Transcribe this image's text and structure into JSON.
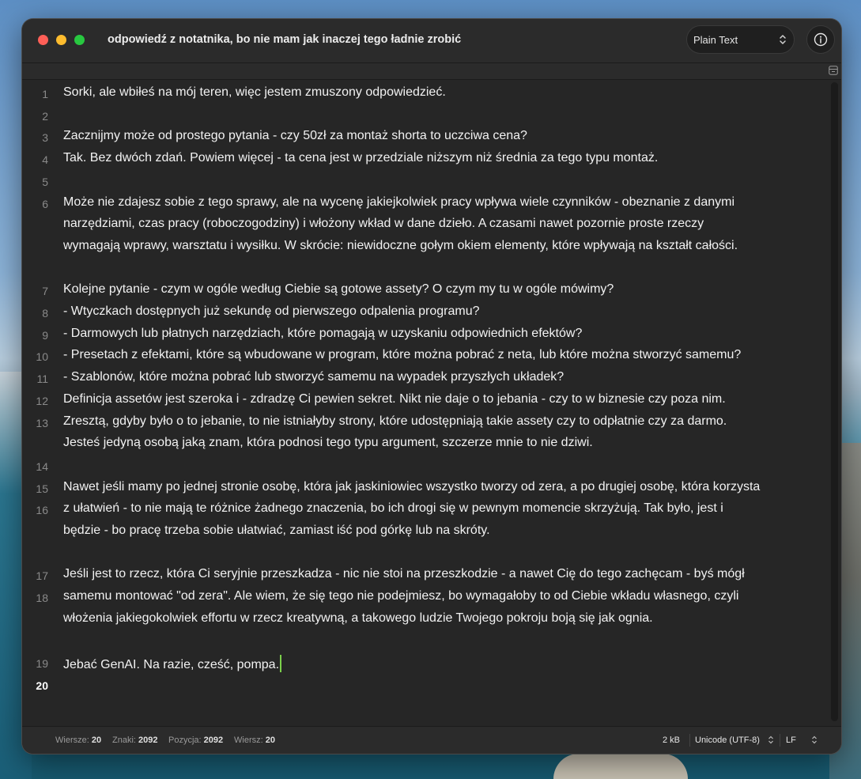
{
  "window": {
    "title": "odpowiedź z notatnika, bo nie mam jak inaczej tego ładnie zrobić",
    "format": "Plain Text"
  },
  "gutter": [
    "1",
    "2",
    "3",
    "4",
    "5",
    "6",
    "7",
    "8",
    "9",
    "10",
    "11",
    "12",
    "13",
    "14",
    "15",
    "16",
    "17",
    "18",
    "19",
    "20"
  ],
  "active_line": "20",
  "lines": [
    "Sorki, ale wbiłeś na mój teren, więc jestem zmuszony odpowiedzieć.",
    "",
    "Zacznijmy może od prostego pytania - czy 50zł za montaż shorta to uczciwa cena?",
    "Tak. Bez dwóch zdań. Powiem więcej - ta cena jest w przedziale niższym niż średnia za tego typu montaż.",
    "",
    "Może nie zdajesz sobie z tego sprawy, ale na wycenę jakiejkolwiek pracy wpływa wiele czynników - obeznanie z danymi",
    "narzędziami, czas pracy (roboczogodziny) i włożony wkład w dane dzieło. A czasami nawet pozornie proste rzeczy",
    "wymagają wprawy, warsztatu i wysiłku. W skrócie: niewidoczne gołym okiem elementy, które wpływają na kształt całości.",
    "",
    "Kolejne pytanie - czym w ogóle według Ciebie są gotowe assety? O czym my tu w ogóle mówimy?",
    "- Wtyczkach dostępnych już sekundę od pierwszego odpalenia programu?",
    "- Darmowych lub płatnych narzędziach, które pomagają w uzyskaniu odpowiednich efektów?",
    "- Presetach z efektami, które są wbudowane w program, które można pobrać z neta, lub które można stworzyć samemu?",
    "- Szablonów, które można pobrać lub stworzyć samemu na wypadek przyszłych układek?",
    "Definicja assetów jest szeroka i - zdradzę Ci pewien sekret. Nikt nie daje o to jebania - czy to w biznesie czy poza nim.",
    "Zresztą, gdyby było o to jebanie, to nie istniałyby strony, które udostępniają takie assety czy to odpłatnie czy za darmo.",
    "Jesteś jedyną osobą jaką znam, która podnosi tego typu argument, szczerze mnie to nie dziwi.",
    "",
    "Nawet jeśli mamy po jednej stronie osobę, która jak jaskiniowiec wszystko tworzy od zera, a po drugiej osobę, która korzysta",
    "z ułatwień - to nie mają te różnice żadnego znaczenia, bo ich drogi się w pewnym momencie skrzyżują. Tak było, jest i",
    "będzie - bo pracę trzeba sobie ułatwiać, zamiast iść pod górkę lub na skróty.",
    "",
    "Jeśli jest to rzecz, która Ci seryjnie przeszkadza - nic nie stoi na przeszkodzie - a nawet Cię do tego zachęcam - byś mógł",
    "samemu montować \"od zera\". Ale wiem, że się tego nie podejmiesz, bo wymagałoby to od Ciebie wkładu własnego, czyli",
    "włożenia jakiegokolwiek effortu w rzecz kreatywną, a takowego ludzie Twojego pokroju boją się jak ognia.",
    "",
    "Jebać GenAI. Na razie, cześć, pompa."
  ],
  "status": {
    "lines_label": "Wiersze:",
    "lines_value": "20",
    "chars_label": "Znaki:",
    "chars_value": "2092",
    "position_label": "Pozycja:",
    "position_value": "2092",
    "lines2_label": "Wiersz:",
    "lines2_value": "20",
    "size": "2 kB",
    "encoding": "Unicode (UTF-8)",
    "line_ending": "LF"
  },
  "colors": {
    "window_bg": "#262626",
    "caret": "#7bd04a",
    "close": "#ff5f57",
    "minimize": "#febc2e",
    "maximize": "#28c840"
  }
}
